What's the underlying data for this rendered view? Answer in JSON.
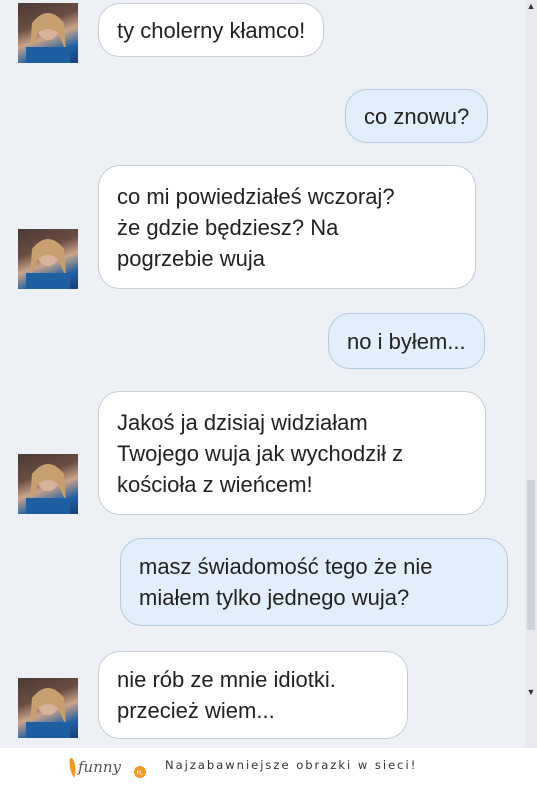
{
  "messages": [
    {
      "side": "in",
      "lines": [
        "ty cholerny kłamco!"
      ]
    },
    {
      "side": "out",
      "lines": [
        "co znowu?"
      ]
    },
    {
      "side": "in",
      "lines": [
        "co mi powiedziałeś wczoraj?",
        "że gdzie będziesz? Na",
        "pogrzebie wuja"
      ]
    },
    {
      "side": "out",
      "lines": [
        "no i byłem..."
      ]
    },
    {
      "side": "in",
      "lines": [
        "Jakoś ja dzisiaj widziałam",
        "Twojego wuja jak wychodził z",
        "kościoła z wieńcem!"
      ]
    },
    {
      "side": "out",
      "lines": [
        "masz świadomość tego że nie",
        "miałem tylko jednego wuja?"
      ]
    },
    {
      "side": "in",
      "lines": [
        "nie rób ze mnie idiotki.",
        "przecież wiem..."
      ]
    }
  ],
  "footer": {
    "logo_text": "funny",
    "logo_suffix": "PL",
    "tagline": "Najzabawniejsze obrazki w sieci!"
  },
  "colors": {
    "incoming_bubble": "#ffffff",
    "outgoing_bubble": "#e3eefb",
    "background": "#edf0f5",
    "logo_orange": "#f29a1f"
  },
  "icons": {
    "avatar": "contact-avatar-photo",
    "scroll_up": "scroll-up-arrow",
    "scroll_down": "scroll-down-arrow"
  }
}
